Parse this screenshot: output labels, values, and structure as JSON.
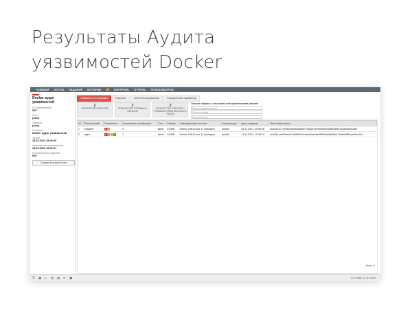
{
  "headline": {
    "line1": "Результаты Аудита",
    "line2": "уязвимостей Docker"
  },
  "nav": {
    "items": [
      "ГЛАВНАЯ",
      "ХОСТЫ",
      "ЗАДАНИЯ",
      "ИСТОРИЯ",
      "КОНТРОЛЬ",
      "ОТЧЕТЫ",
      "ПОЛЬЗОВАТЕЛИ"
    ]
  },
  "sidebar": {
    "title": "Docker аудит уязвимостей",
    "fields": [
      {
        "label": "ID сканирования",
        "value": "629"
      },
      {
        "label": "Хост",
        "value": "proxy"
      },
      {
        "label": "Задание",
        "value": "proxy"
      },
      {
        "label": "Профиль",
        "value": "Docker аудит уязвимостей"
      },
      {
        "label": "Запуск",
        "value": "15.02.2022 15:00:26"
      },
      {
        "label": "Завершение сканирования",
        "value": "15.02.2022 15:02:27"
      },
      {
        "label": "ID выполнения задания",
        "value": "629"
      }
    ],
    "button": "Создать быстрый отчет"
  },
  "tabs": [
    "Уязвимости по образам",
    "Результат",
    "JSON-Фильтрованные",
    "Расширенные параметры"
  ],
  "stats": [
    {
      "num": "2",
      "caption": "КОЛИЧЕСТВО ОБРАЗОВ"
    },
    {
      "num": "2",
      "caption": "КОЛИЧЕСТВО УЯЗВИМЫХ ОБРАЗОВ"
    },
    {
      "num": "2",
      "caption": "КОЛИЧЕСТВО ОБРАЗОВ С УЯЗВИМОСТЯМИ ВЫСОКОГО РИСКА"
    }
  ],
  "filters": {
    "title": "Только образы с высоким или критическим риском",
    "ph1": "Поиск по репозиториям",
    "ph2": "Поиск по тегам",
    "ph3": "Поиск по хешу"
  },
  "table": {
    "headers": [
      "ID",
      "Репозиторий",
      "Уязвимости",
      "Количество контейнеров",
      "Теги",
      "Размер",
      "Операционная система",
      "Архитектура",
      "Дата создания",
      "Имя образа (хеш)"
    ],
    "rows": [
      {
        "id": "1",
        "repo": "postgres",
        "sev": [
          "4",
          "15"
        ],
        "containers": "0",
        "tag": "latest",
        "size": "374MB",
        "os": "Debian GNU/Linux 11 (bullseye)",
        "arch": "amd64",
        "date": "08.11.2021, 00:55:48",
        "hash": "sha256:577e53b2f4cb9dda8d9775da2e1be9bb4bfe3c8f9f2abfd7edabd559ca89"
      },
      {
        "id": "2",
        "repo": "nginx",
        "sev": [
          "4",
          "16",
          "2",
          "1"
        ],
        "containers": "1",
        "tag": "latest",
        "size": "141MB",
        "os": "Debian GNU/Linux 11 (bullseye)",
        "arch": "amd64",
        "date": "17.11.2021, 13:38:14",
        "hash": "sha256:ea335eea17ab984571e4a4e4be9ae3f9b6da8a8df5c17b8a4df68caeb5ee93c"
      }
    ]
  },
  "pager": "Всего: 2",
  "version": "2.6.9.6407 | 2.6.9.6407",
  "colors": {
    "accent": "#d9534f",
    "nav": "#5a6a76",
    "critical": "#c0392b",
    "high": "#e67e22",
    "medium": "#f1c40f",
    "low": "#27ae60"
  }
}
